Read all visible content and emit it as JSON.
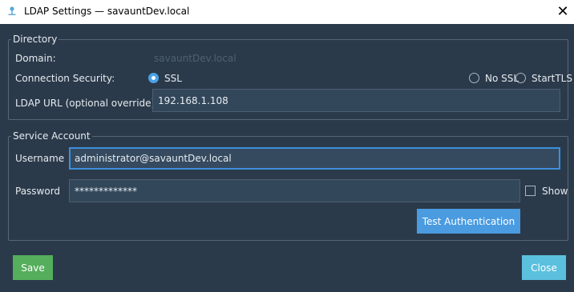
{
  "window": {
    "title": "LDAP Settings — savauntDev.local",
    "close_glyph": "✕"
  },
  "directory": {
    "legend": "Directory",
    "domain_label": "Domain:",
    "domain_value": "savauntDev.local",
    "security_label": "Connection Security:",
    "security_options": [
      {
        "label": "SSL",
        "selected": true
      },
      {
        "label": "No SSL",
        "selected": false
      },
      {
        "label": "StartTLS",
        "selected": false
      }
    ],
    "url_label": "LDAP URL (optional override):",
    "url_value": "192.168.1.108"
  },
  "service_account": {
    "legend": "Service Account",
    "username_label": "Username",
    "username_value": "administrator@savauntDev.local",
    "password_label": "Password",
    "password_value": "*************",
    "show_label": "Show",
    "show_checked": false,
    "test_button": "Test Authentication"
  },
  "footer": {
    "save_button": "Save",
    "close_button": "Close"
  },
  "colors": {
    "background": "#2b3a4a",
    "accent": "#4a9be0",
    "save": "#55ae5c",
    "close": "#5bc0de"
  }
}
